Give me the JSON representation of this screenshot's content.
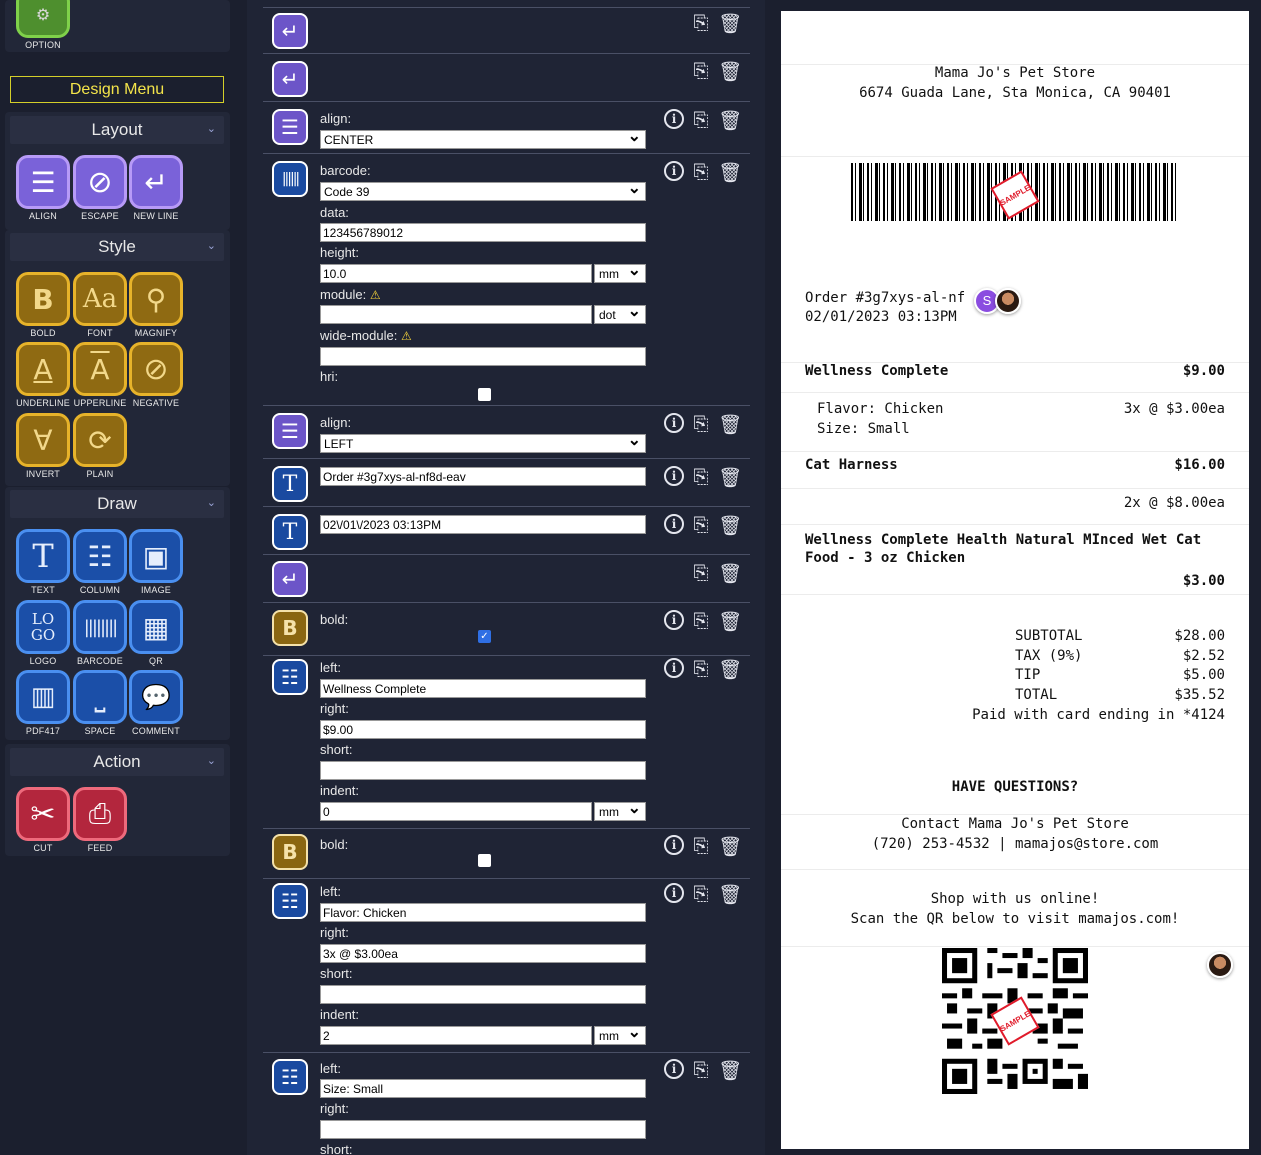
{
  "sidebar": {
    "option_label": "OPTION",
    "design_menu": "Design Menu",
    "sections": {
      "layout": "Layout",
      "style": "Style",
      "draw": "Draw",
      "action": "Action"
    },
    "layout_tools": [
      {
        "label": "ALIGN",
        "icon": "align-icon"
      },
      {
        "label": "ESCAPE",
        "icon": "escape-icon"
      },
      {
        "label": "NEW LINE",
        "icon": "new-line-icon"
      }
    ],
    "style_tools": [
      {
        "label": "BOLD",
        "glyph": "B"
      },
      {
        "label": "FONT",
        "glyph": "Aa"
      },
      {
        "label": "MAGNIFY",
        "glyph": "🔍"
      },
      {
        "label": "UNDERLINE",
        "glyph": "A"
      },
      {
        "label": "UPPERLINE",
        "glyph": "A"
      },
      {
        "label": "NEGATIVE",
        "glyph": "⊘"
      },
      {
        "label": "INVERT",
        "glyph": "∀"
      },
      {
        "label": "PLAIN",
        "glyph": "⟳"
      }
    ],
    "draw_tools": [
      {
        "label": "TEXT",
        "glyph": "T"
      },
      {
        "label": "COLUMN",
        "glyph": "☰"
      },
      {
        "label": "IMAGE",
        "glyph": "▣"
      },
      {
        "label": "LOGO",
        "glyph": "LOGO"
      },
      {
        "label": "BARCODE",
        "glyph": "|||||"
      },
      {
        "label": "QR",
        "glyph": "▦"
      },
      {
        "label": "PDF417",
        "glyph": "▥"
      },
      {
        "label": "SPACE",
        "glyph": "⎵"
      },
      {
        "label": "COMMENT",
        "glyph": "…"
      }
    ],
    "action_tools": [
      {
        "label": "CUT",
        "glyph": "✂"
      },
      {
        "label": "FEED",
        "glyph": "⎙"
      }
    ]
  },
  "commands": {
    "align1": {
      "label": "align:",
      "value": "CENTER"
    },
    "barcode": {
      "label": "barcode:",
      "value": "Code 39",
      "data_label": "data:",
      "data_value": "123456789012",
      "height_label": "height:",
      "height_value": "10.0",
      "height_unit": "mm",
      "module_label": "module:",
      "module_value": "",
      "module_unit": "dot",
      "wide_label": "wide-module:",
      "wide_value": "",
      "hri_label": "hri:"
    },
    "align2": {
      "label": "align:",
      "value": "LEFT"
    },
    "text1": {
      "value": "Order #3g7xys-al-nf8d-eav"
    },
    "text2": {
      "value": "02\\/01\\/2023 03:13PM"
    },
    "bold1": {
      "label": "bold:",
      "checked": true
    },
    "col1": {
      "left_label": "left:",
      "left_value": "Wellness Complete",
      "right_label": "right:",
      "right_value": "$9.00",
      "short_label": "short:",
      "short_value": "",
      "indent_label": "indent:",
      "indent_value": "0",
      "indent_unit": "mm"
    },
    "bold2": {
      "label": "bold:",
      "checked": false
    },
    "col2": {
      "left_label": "left:",
      "left_value": "Flavor: Chicken",
      "right_label": "right:",
      "right_value": "3x @ $3.00ea",
      "short_label": "short:",
      "short_value": "",
      "indent_label": "indent:",
      "indent_value": "2",
      "indent_unit": "mm"
    },
    "col3": {
      "left_label": "left:",
      "left_value": "Size: Small",
      "right_label": "right:",
      "right_value": "",
      "short_label": "short:"
    }
  },
  "receipt": {
    "store_name": "Mama Jo's Pet Store",
    "store_address": "6674 Guada Lane, Sta Monica, CA 90401",
    "stamp_text": "SAMPLE",
    "order_line": "Order #3g7xys-al-nf",
    "order_date": "02/01/2023 03:13PM",
    "avatar_initial": "S",
    "item1_name": "Wellness Complete",
    "item1_price": "$9.00",
    "item1_flavor": "Flavor: Chicken",
    "item1_qty": "3x @ $3.00ea",
    "item1_size": "Size: Small",
    "item2_name": "Cat Harness",
    "item2_price": "$16.00",
    "item2_qty": "2x @ $8.00ea",
    "item3_name_line1": "Wellness Complete Health Natural MInced Wet Cat",
    "item3_name_line2": "Food - 3 oz Chicken",
    "item3_price": "$3.00",
    "subtotal_label": "SUBTOTAL",
    "subtotal_value": "$28.00",
    "tax_label": "TAX (9%)",
    "tax_value": "$2.52",
    "tip_label": "TIP",
    "tip_value": "$5.00",
    "total_label": "TOTAL",
    "total_value": "$35.52",
    "paid_line": "Paid with card ending in *4124",
    "questions": "HAVE QUESTIONS?",
    "contact_line": "Contact Mama Jo's Pet Store",
    "contact_phone": "(720) 253-4532 | mamajos@store.com",
    "shop_line": "Shop with us online!",
    "scan_line": "Scan the QR below to visit mamajos.com!"
  },
  "colors": {
    "background": "#1b1f2e",
    "purple": "#7a62d9",
    "gold": "#e7b32a",
    "blue": "#4a8ff0",
    "red": "#ee6a7c",
    "design_menu": "#f4e44a"
  }
}
